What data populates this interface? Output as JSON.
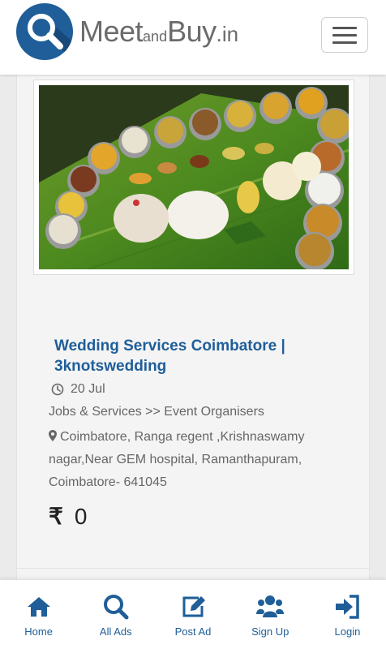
{
  "header": {
    "logo": {
      "part1": "Meet",
      "part2": "and",
      "part3": "Buy",
      "part4": ".in"
    },
    "menu_icon": "hamburger-menu-icon"
  },
  "listing": {
    "image_alt": "Traditional banana leaf feast with rice and side dishes",
    "title": "Wedding Services Coimbatore | 3knotswedding",
    "date": "20 Jul",
    "category": "Jobs & Services >> Event Organisers",
    "address": "Coimbatore, Ranga regent ,Krishnaswamy nagar,Near GEM hospital, Ramanthapuram, Coimbatore- 641045",
    "currency": "₹",
    "price": "0"
  },
  "bottom_nav": {
    "items": [
      {
        "label": "Home",
        "icon": "home-icon"
      },
      {
        "label": "All Ads",
        "icon": "search-icon"
      },
      {
        "label": "Post Ad",
        "icon": "edit-icon"
      },
      {
        "label": "Sign Up",
        "icon": "users-icon"
      },
      {
        "label": "Login",
        "icon": "login-icon"
      }
    ]
  },
  "colors": {
    "brand": "#1f5e99",
    "text_muted": "#666666"
  }
}
